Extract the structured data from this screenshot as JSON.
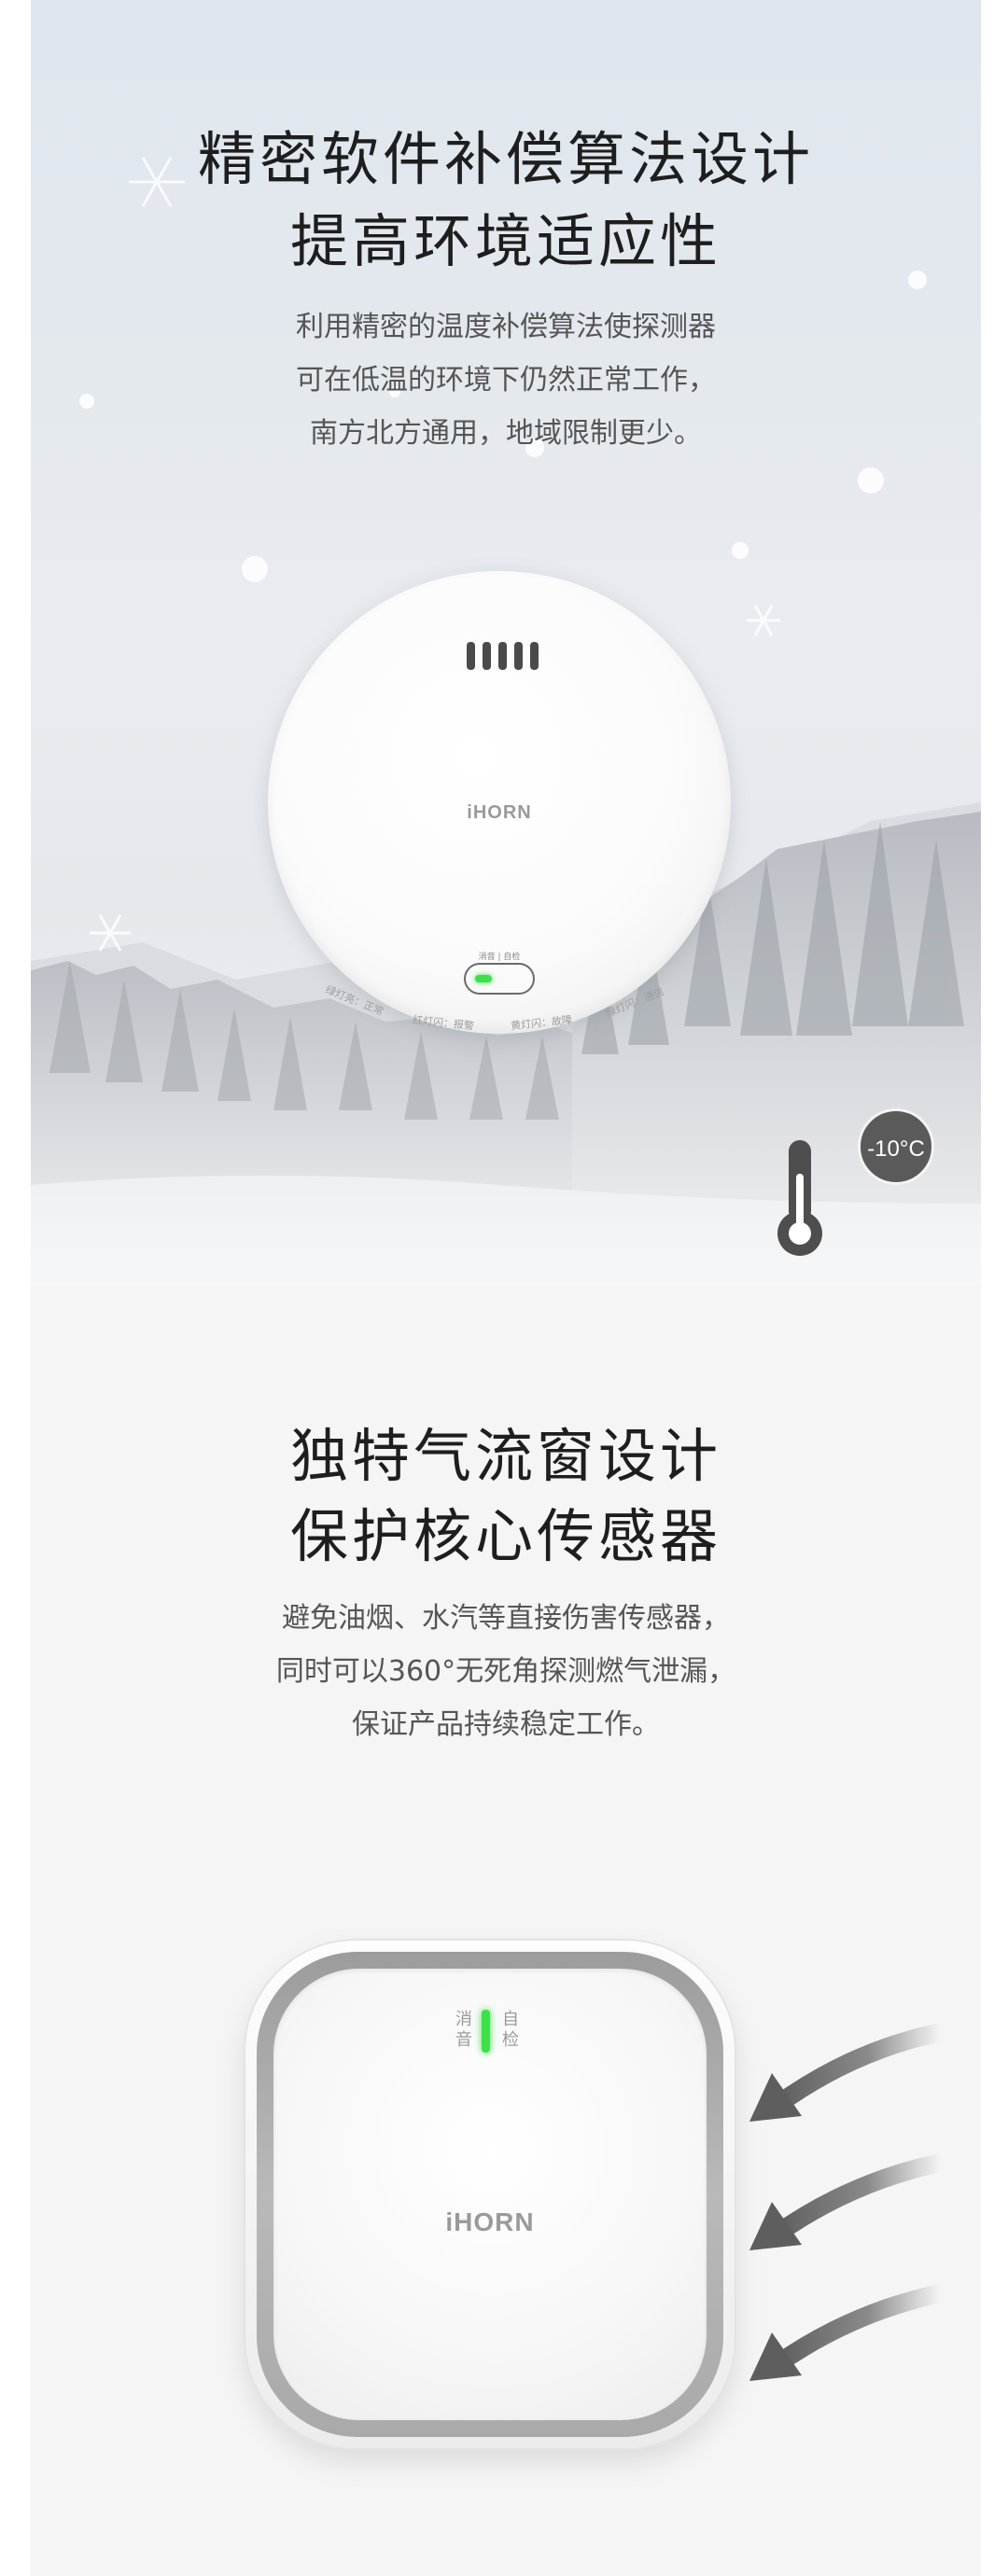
{
  "section_cold": {
    "title_line1": "精密软件补偿算法设计",
    "title_line2": "提高环境适应性",
    "desc_line1": "利用精密的温度补偿算法使探测器",
    "desc_line2": "可在低温的环境下仍然正常工作，",
    "desc_line3": "南方北方通用，地域限制更少。",
    "detector": {
      "brand": "iHORN",
      "button_label": "消音 | 自检",
      "indicators": [
        "绿灯亮：正常",
        "红灯闪：报警",
        "黄灯闪：故障",
        "绿灯闪：通信"
      ]
    },
    "temperature": "-10°C",
    "icons": [
      "thermometer-icon",
      "snowflake-icon"
    ]
  },
  "section_airflow": {
    "title_line1": "独特气流窗设计",
    "title_line2": "保护核心传感器",
    "desc_line1": "避免油烟、水汽等直接伤害传感器，",
    "desc_line2": "同时可以360°无死角探测燃气泄漏，",
    "desc_line3": "保证产品持续稳定工作。",
    "detector": {
      "brand": "iHORN",
      "left_label": "消音",
      "right_label": "自检"
    },
    "icons": [
      "airflow-arrow-icon"
    ]
  },
  "colors": {
    "led_green": "#3ee04a",
    "badge_gray": "#5a5a5a",
    "heading": "#1e1e1e",
    "body_text": "#555555"
  }
}
